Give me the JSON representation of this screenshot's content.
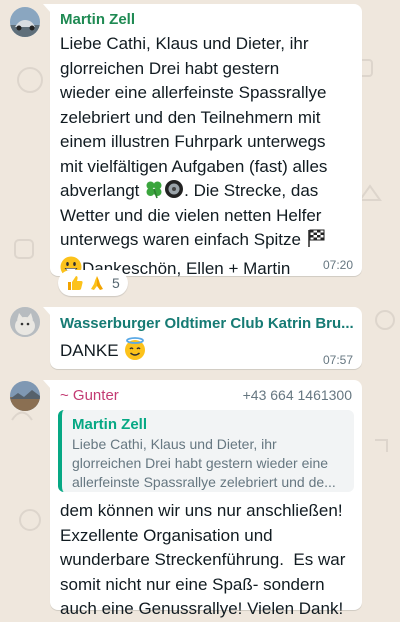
{
  "colors": {
    "wallpaper": "#efe7dd",
    "sender_green": "#1f8a53",
    "sender_teal": "#167b74",
    "sender_pink": "#c33b73",
    "quote_accent": "#06a884"
  },
  "messages": [
    {
      "sender": "Martin Zell",
      "avatar_icon": "car-photo-avatar",
      "lines": [
        "Liebe Cathi, Klaus und Dieter, ihr",
        "glorreichen Drei habt gestern",
        "wieder eine allerfeinste Spassrallye",
        "zelebriert und den Teilnehmern mit",
        "einem illustren Fuhrpark unterwegs",
        "mit vielfältigen Aufgaben (fast) alles"
      ],
      "line7": "abverlangt",
      "line7_icons": [
        "four-leaf-clover-icon",
        "wheel-icon"
      ],
      "line7_tail": ". Die Strecke, das",
      "line8": "Wetter und die vielen netten Helfer",
      "line9": "unterwegs waren einfach Spitze",
      "line9_icon": "chequered-flag-icon",
      "line10_icon": "grinning-face-icon",
      "line10": "Dankeschön, Ellen + Martin",
      "time": "07:20",
      "reactions": {
        "icons": [
          "thumbs-up-icon",
          "folded-hands-icon"
        ],
        "count": "5"
      }
    },
    {
      "sender": "Wasserburger Oldtimer Club Katrin Bru...",
      "avatar_icon": "cat-photo-avatar",
      "text": "DANKE",
      "text_icon": "smiling-face-with-halo-icon",
      "time": "07:57"
    },
    {
      "sender": "~ Gunter",
      "phone": "+43 664 1461300",
      "avatar_icon": "landscape-photo-avatar",
      "quote": {
        "author": "Martin Zell",
        "lines": [
          "Liebe Cathi, Klaus und Dieter, ihr",
          "glorreichen Drei habt gestern wieder eine",
          "allerfeinste Spassrallye zelebriert und de..."
        ]
      },
      "lines": [
        "dem können wir uns nur anschließen!",
        "Exzellente Organisation und",
        "wunderbare Streckenführung.  Es war",
        "somit nicht nur eine Spaß- sondern",
        "auch eine Genussrallye! Vielen Dank!"
      ]
    }
  ]
}
